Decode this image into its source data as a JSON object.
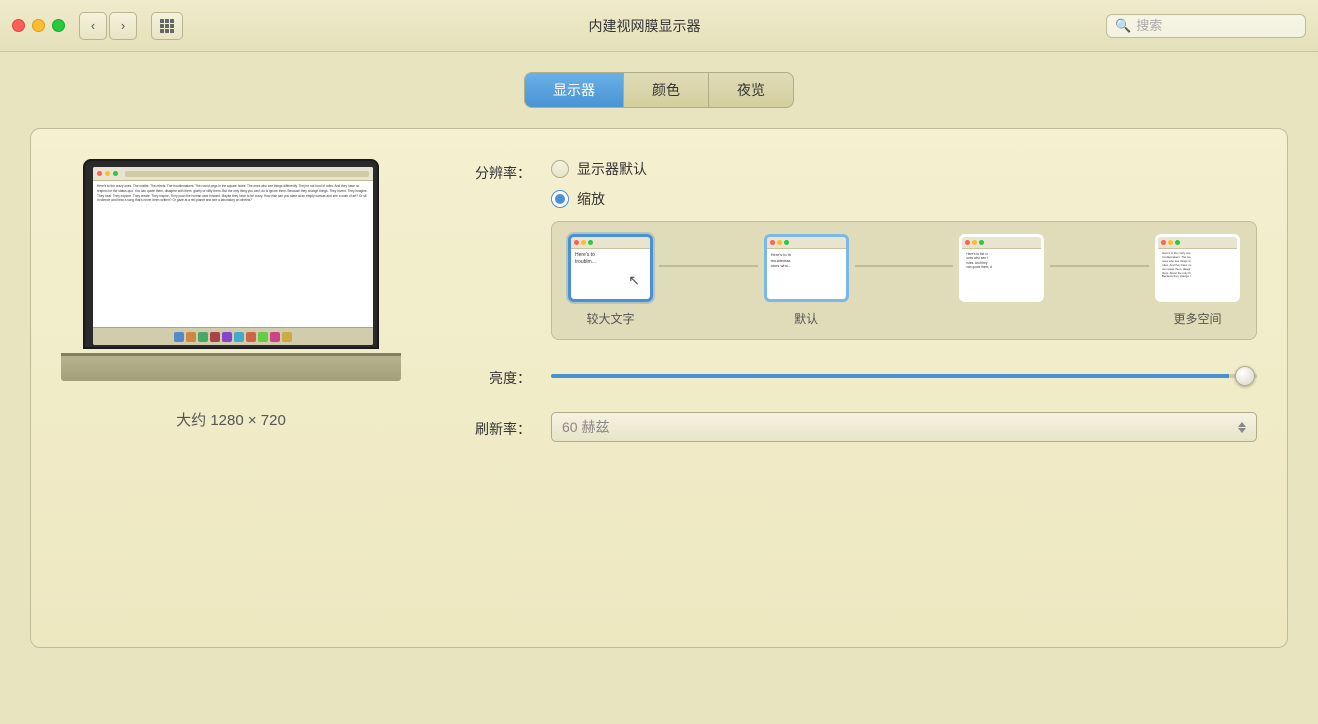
{
  "titlebar": {
    "title": "内建视网膜显示器",
    "search_placeholder": "搜索",
    "nav_back": "‹",
    "nav_forward": "›",
    "grid": "⊞"
  },
  "tabs": {
    "items": [
      {
        "id": "display",
        "label": "显示器",
        "active": true
      },
      {
        "id": "color",
        "label": "颜色",
        "active": false
      },
      {
        "id": "night",
        "label": "夜览",
        "active": false
      }
    ]
  },
  "display": {
    "resolution_label": "分辨率：",
    "resolution_options": [
      {
        "id": "default",
        "label": "显示器默认",
        "selected": false
      },
      {
        "id": "scaled",
        "label": "缩放",
        "selected": true
      }
    ],
    "scale_options": [
      {
        "id": "larger",
        "label": "较大文字"
      },
      {
        "id": "default",
        "label": "默认"
      },
      {
        "id": "more",
        "label": "更多空间"
      }
    ],
    "laptop_size": "大约 1280 × 720",
    "brightness_label": "亮度：",
    "brightness_value": 96,
    "refresh_label": "刷新率：",
    "refresh_value": "60 赫兹",
    "screen_text": "Here's to the crazy ones. The misfits. The rebels. The troublemakers. The round pegs in the square holes.\n\nThe ones who see things differently. They're not fond of rules. And they have no respect for the status quo. You can quote them, disagree with them, glorify or vilify them.\n\nBut the only thing you can't do is ignore them. Because they change things. They invent. They imagine. They heal. They explore. They create. They inspire. They push the human race forward.\n\nMaybe they have to be crazy.\n\nHow else can you stare at an empty canvas and see a work of art? Or sit in silence and hear a song that's never been written? Or gaze at a red planet and see a laboratory on wheels?"
  }
}
